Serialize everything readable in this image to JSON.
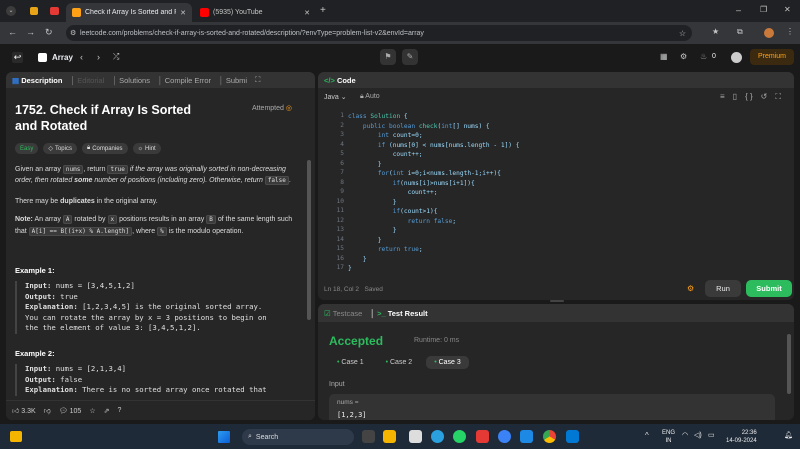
{
  "browser": {
    "tabs": [
      {
        "label": "Check if Array Is Sorted and Ro"
      },
      {
        "label": "(5935) YouTube"
      }
    ],
    "url": "leetcode.com/problems/check-if-array-is-sorted-and-rotated/description/?envType=problem-list-v2&envId=array"
  },
  "lc": {
    "breadcrumb": "Array",
    "coins": "0",
    "premium": "Premium"
  },
  "left": {
    "tabs": [
      "Description",
      "Editorial",
      "Solutions",
      "Compile Error",
      "Submi"
    ],
    "title": "1752. Check if Array Is Sorted and Rotated",
    "status": "Attempted",
    "tags": [
      "Easy",
      "Topics",
      "Companies",
      "Hint"
    ],
    "para1": [
      "Given an array ",
      "nums",
      ", return ",
      "true",
      " if the array was originally sorted in non-decreasing order, then rotated ",
      "some",
      " number of positions (including zero). Otherwise, return ",
      "false",
      "."
    ],
    "para2": [
      "There may be ",
      "duplicates",
      " in the original array."
    ],
    "para3": [
      "Note:",
      " An array ",
      "A",
      " rotated by ",
      "x",
      " positions results in an array ",
      "B",
      " of the same length such that ",
      "A[i] == B[(i+x) % A.length]",
      ", where ",
      "%",
      " is the modulo operation."
    ],
    "example1": {
      "title": "Example 1:",
      "lines": [
        [
          "Input:",
          "nums = [3,4,5,1,2]"
        ],
        [
          "Output:",
          "true"
        ],
        [
          "Explanation:",
          "[1,2,3,4,5] is the original sorted array."
        ],
        [
          "",
          "You can rotate the array by x = 3 positions to begin on"
        ],
        [
          "",
          "the the element of value 3: [3,4,5,1,2]."
        ]
      ]
    },
    "example2": {
      "title": "Example 2:",
      "lines": [
        [
          "Input:",
          "nums = [2,1,3,4]"
        ],
        [
          "Output:",
          "false"
        ],
        [
          "Explanation:",
          "There is no sorted array once rotated that"
        ]
      ]
    },
    "footer": {
      "likes": "3.3K",
      "comments": "105"
    }
  },
  "code": {
    "header": "Code",
    "language": "Java",
    "mode": "Auto",
    "lines": [
      "class Solution {",
      "    public boolean check(int[] nums) {",
      "        int count=0;",
      "        if (nums[0] < nums[nums.length - 1]) {",
      "            count++;",
      "        }",
      "        for(int i=0;i<nums.length-1;i++){",
      "            if(nums[i]>nums[i+1]){",
      "                count++;",
      "            }",
      "            if(count>1){",
      "                return false;",
      "            }",
      "        }",
      "        return true;",
      "    }",
      "}"
    ],
    "status": "Ln 18, Col 2",
    "saved": "Saved",
    "run": "Run",
    "submit": "Submit"
  },
  "test": {
    "tabs": [
      "Testcase",
      "Test Result"
    ],
    "result": "Accepted",
    "runtime": "Runtime: 0 ms",
    "cases": [
      "Case 1",
      "Case 2",
      "Case 3"
    ],
    "input_label": "Input",
    "var_label": "nums =",
    "var_value": "[1,2,3]"
  },
  "taskbar": {
    "search": "Search",
    "lang1": "ENG",
    "lang2": "IN",
    "time": "22:36",
    "date": "14-09-2024"
  },
  "colors": {
    "accent": "#ffa116",
    "easy": "#2cbb5d",
    "submit": "#2cbb5d",
    "accepted": "#2cbb5d"
  }
}
